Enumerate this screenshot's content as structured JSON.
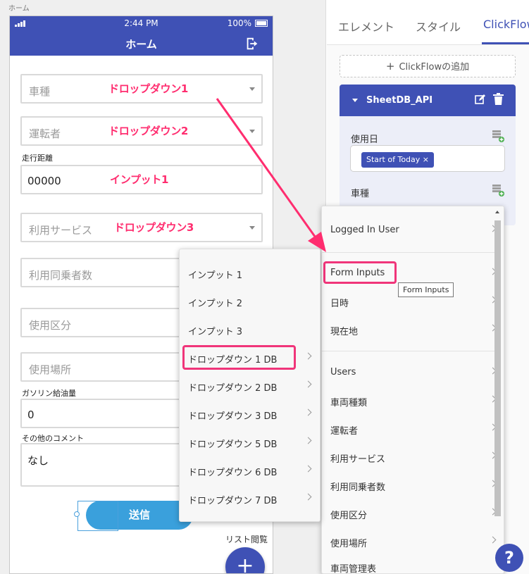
{
  "canvas": {
    "page_caption": "ホーム"
  },
  "phone": {
    "status": {
      "time": "2:44 PM",
      "battery": "100%"
    },
    "title": "ホーム",
    "fields": [
      {
        "label": "",
        "placeholder": "車種",
        "annotation": "ドロップダウン1"
      },
      {
        "label": "",
        "placeholder": "運転者",
        "annotation": "ドロップダウン2"
      },
      {
        "label": "走行距離",
        "value": "00000",
        "annotation": "インプット1"
      },
      {
        "label": "",
        "placeholder": "利用サービス",
        "annotation": "ドロップダウン3"
      },
      {
        "label": "",
        "placeholder": "利用同乗者数"
      },
      {
        "label": "",
        "placeholder": "使用区分"
      },
      {
        "label": "",
        "placeholder": "使用場所"
      },
      {
        "label": "ガソリン給油量",
        "value": "0"
      },
      {
        "label": "その他のコメント",
        "value": "なし"
      }
    ],
    "submit_label": "送信",
    "list_link": "リスト閲覧",
    "fab_label": "+"
  },
  "panel": {
    "tabs": [
      "エレメント",
      "スタイル",
      "ClickFlow"
    ],
    "active_tab": "ClickFlow",
    "add_clickflow": "ClickFlowの追加",
    "card": {
      "title": "SheetDB_API",
      "fields": [
        {
          "label": "使用日",
          "chip": "Start of Today"
        },
        {
          "label": "車種"
        }
      ]
    }
  },
  "menu_right": {
    "items": [
      {
        "label": "Logged In User"
      },
      {
        "label": "Form Inputs",
        "highlighted": true
      },
      {
        "label": "日時"
      },
      {
        "label": "現在地"
      },
      {
        "label": "Users"
      },
      {
        "label": "車両種類"
      },
      {
        "label": "運転者"
      },
      {
        "label": "利用サービス"
      },
      {
        "label": "利用同乗者数"
      },
      {
        "label": "使用区分"
      },
      {
        "label": "使用場所"
      },
      {
        "label": "車両管理表"
      }
    ],
    "tooltip": "Form Inputs"
  },
  "menu_left": {
    "items": [
      {
        "label": "インプット 1"
      },
      {
        "label": "インプット 2"
      },
      {
        "label": "インプット 3"
      },
      {
        "label": "ドロップダウン 1 DB",
        "highlighted": true
      },
      {
        "label": "ドロップダウン 2 DB"
      },
      {
        "label": "ドロップダウン 3 DB"
      },
      {
        "label": "ドロップダウン 5 DB"
      },
      {
        "label": "ドロップダウン 6 DB"
      },
      {
        "label": "ドロップダウン 7 DB"
      }
    ]
  },
  "help_label": "?",
  "colors": {
    "primary": "#3f51b5",
    "annotation": "#ff2d6f",
    "submit": "#3aa0dc"
  }
}
